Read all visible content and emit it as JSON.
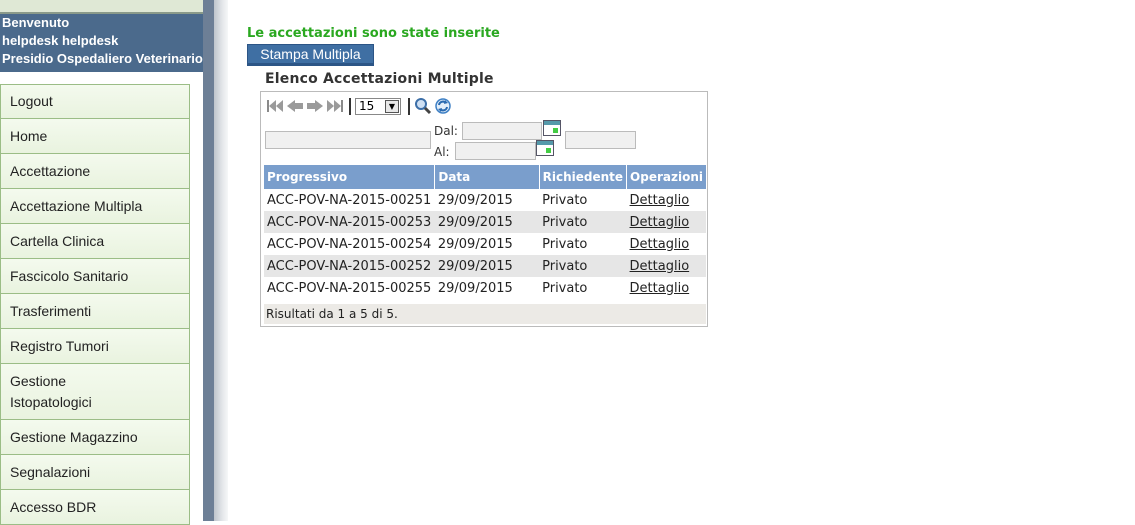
{
  "sidebar": {
    "greeting": "Benvenuto",
    "username": "helpdesk helpdesk",
    "organization": "Presidio Ospedaliero Veterinario",
    "menu": [
      {
        "label": "Logout",
        "name": "logout"
      },
      {
        "label": "Home",
        "name": "home"
      },
      {
        "label": "Accettazione",
        "name": "accettazione"
      },
      {
        "label": "Accettazione Multipla",
        "name": "accettazione-multipla"
      },
      {
        "label": "Cartella Clinica",
        "name": "cartella-clinica"
      },
      {
        "label": "Fascicolo Sanitario",
        "name": "fascicolo-sanitario"
      },
      {
        "label": "Trasferimenti",
        "name": "trasferimenti"
      },
      {
        "label": "Registro Tumori",
        "name": "registro-tumori"
      },
      {
        "label": "Gestione Istopatologici",
        "name": "gestione-istopatologici",
        "tall": true
      },
      {
        "label": "Gestione Magazzino",
        "name": "gestione-magazzino"
      },
      {
        "label": "Segnalazioni",
        "name": "segnalazioni"
      },
      {
        "label": "Accesso BDR",
        "name": "accesso-bdr"
      }
    ]
  },
  "main": {
    "success_message": "Le accettazioni sono state inserite",
    "print_button": "Stampa Multipla",
    "list_title": "Elenco Accettazioni Multiple",
    "toolbar": {
      "page_size": "15"
    },
    "filters": {
      "dal_label": "Dal:",
      "al_label": "Al:"
    },
    "table": {
      "headers": [
        "Progressivo",
        "Data",
        "Richiedente",
        "Operazioni"
      ],
      "rows": [
        [
          "ACC-POV-NA-2015-00251",
          "29/09/2015",
          "Privato",
          "Dettaglio"
        ],
        [
          "ACC-POV-NA-2015-00253",
          "29/09/2015",
          "Privato",
          "Dettaglio"
        ],
        [
          "ACC-POV-NA-2015-00254",
          "29/09/2015",
          "Privato",
          "Dettaglio"
        ],
        [
          "ACC-POV-NA-2015-00252",
          "29/09/2015",
          "Privato",
          "Dettaglio"
        ],
        [
          "ACC-POV-NA-2015-00255",
          "29/09/2015",
          "Privato",
          "Dettaglio"
        ]
      ]
    },
    "results": "Risultati da 1 a 5 di 5."
  },
  "colors": {
    "success": "#2aa820",
    "header_blue": "#7a9ecc",
    "button_blue": "#3f6fa3",
    "sidebar_user_bg": "#4b6a8c",
    "menu_border": "#9bbd86"
  },
  "icons": [
    "first-page-icon",
    "prev-page-icon",
    "next-page-icon",
    "last-page-icon",
    "search-icon",
    "refresh-icon",
    "calendar-icon"
  ]
}
